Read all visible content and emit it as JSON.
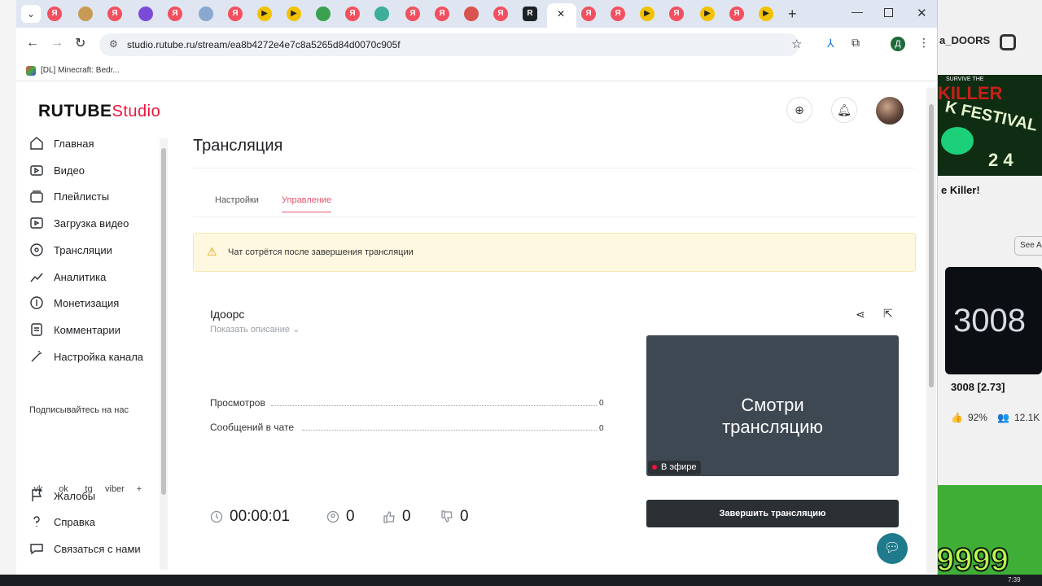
{
  "browser": {
    "url": "studio.rutube.ru/stream/ea8b4272e4e7c8a5265d84d0070c905f",
    "bookmark": "[DL] Minecraft: Bedr...",
    "profile_initial": "Д",
    "active_tab_close": "✕",
    "new_tab": "+",
    "tab_letter": "Я"
  },
  "app": {
    "logo_main": "RUTUBE",
    "logo_sub": "Studio"
  },
  "sidebar": {
    "items": [
      {
        "label": "Главная",
        "icon": "home-icon"
      },
      {
        "label": "Видео",
        "icon": "video-icon"
      },
      {
        "label": "Плейлисты",
        "icon": "playlist-icon"
      },
      {
        "label": "Загрузка видео",
        "icon": "upload-icon"
      },
      {
        "label": "Трансляции",
        "icon": "broadcast-icon"
      },
      {
        "label": "Аналитика",
        "icon": "analytics-icon"
      },
      {
        "label": "Монетизация",
        "icon": "money-icon"
      },
      {
        "label": "Комментарии",
        "icon": "comments-icon"
      },
      {
        "label": "Настройка канала",
        "icon": "wand-icon"
      }
    ],
    "follow_title": "Подписывайтесь на нас",
    "social": [
      "vk",
      "ok",
      "tg",
      "viber",
      "+"
    ],
    "bottom_items": [
      {
        "label": "Жалобы",
        "icon": "flag-icon"
      },
      {
        "label": "Справка",
        "icon": "help-icon"
      },
      {
        "label": "Связаться с нами",
        "icon": "chat-icon"
      }
    ]
  },
  "main": {
    "title": "Трансляция",
    "tabs": [
      {
        "label": "Настройки",
        "active": false
      },
      {
        "label": "Управление",
        "active": true
      }
    ],
    "notice": "Чат сотрётся после завершения трансляции",
    "stream": {
      "name": "Iдоорс",
      "show_description": "Показать описание",
      "stats": [
        {
          "label": "Просмотров",
          "value": "0"
        },
        {
          "label": "Сообщений в чате",
          "value": "0"
        }
      ],
      "timer": "00:00:01",
      "viewers": "0",
      "likes": "0",
      "dislikes": "0",
      "preview_text_1": "Смотри",
      "preview_text_2": "трансляцию",
      "live_badge": "В эфире",
      "end_button": "Завершить трансляцию"
    }
  },
  "right_panel": {
    "channel": "a_DOORS",
    "thumb1_top": "SURVIVE THE",
    "thumb1_title": "KILLER",
    "thumb1_sub": "K FESTIVAL",
    "thumb1_num": "2 4",
    "video1_title": "e Killer!",
    "see_all": "See A",
    "thumb2_text": "3008",
    "video2_title": "3008 [2.73]",
    "video2_rating": "92%",
    "video2_players": "12.1K",
    "thumb3_text": "9999"
  },
  "taskbar": {
    "time": "7:39"
  },
  "colors": {
    "accent": "#ed143b",
    "tab_active_text": "#e4566b",
    "notice_bg": "#fff8e1",
    "dark_button": "#2b3035",
    "preview_bg": "#3e4852",
    "help_fab": "#1f7a8c"
  }
}
